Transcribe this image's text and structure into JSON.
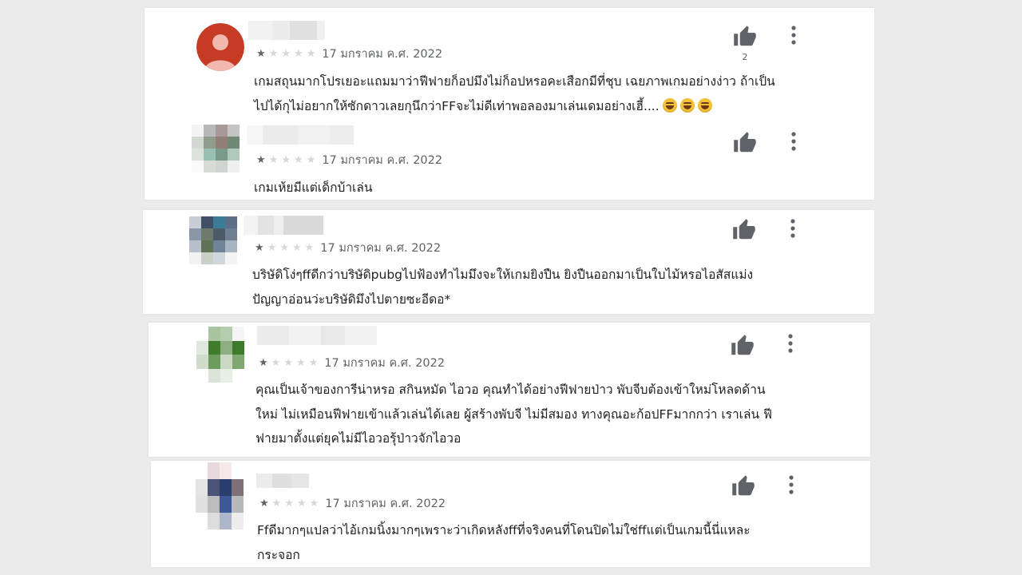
{
  "colors": {
    "background": "#ebebeb",
    "card": "#ffffff",
    "text": "#202124",
    "meta": "#5f6368",
    "star_filled": "#5f6368",
    "star_empty": "#d7d7d7",
    "avatar_1": "#c63b23"
  },
  "icons": {
    "like": "thumbs-up-icon",
    "more": "more-vertical-icon",
    "star": "star-icon",
    "emoji": "face-with-tears-of-joy-icon"
  },
  "reviews": [
    {
      "rating": 1,
      "max_rating": 5,
      "date": "17 มกราคม ค.ศ. 2022",
      "likes": "2",
      "text_lines": [
        "เกมสถุนมากโปรเยอะแถมมาว่าฟีฟายก็อปมึงไม่ก็อปหรอคะเสือกมีที่ชุบ เฉยภาพเกมอย่างง่าว ถ้าเป็น",
        "ไปได้กุไม่อยากให้ซักดาวเลยกุนึกว่าFFจะไม่ดีเท่าพอลองมาเล่นเดมอย่างเฮี้...."
      ],
      "emoji": "😂😂😂"
    },
    {
      "rating": 1,
      "max_rating": 5,
      "date": "17 มกราคม ค.ศ. 2022",
      "likes": "",
      "text_lines": [
        "เกมเห้ยมีแต่เด็กบ้าเล่น"
      ]
    },
    {
      "rating": 1,
      "max_rating": 5,
      "date": "17 มกราคม ค.ศ. 2022",
      "likes": "",
      "text_lines": [
        "บริษัดิโง่ๆffดีกว่าบริษัดิpubgไปฟ้องทำไมมึงจะให้เกมยิงปืน ยิงปืนออกมาเป็นใบไม้หรอไอสัสแม่ง",
        "ปัญญาอ่อนว่ะบริษัดิมึงไปตายซะอีดอ*"
      ]
    },
    {
      "rating": 1,
      "max_rating": 5,
      "date": "17 มกราคม ค.ศ. 2022",
      "likes": "",
      "text_lines": [
        "คุณเป็นเจ้าของการีน่าหรอ สกินหมัด ไอวอ คุณทำได้อย่างฟีฟายป่าว พับจีบต้องเข้าใหม่โหลดด้าน",
        "ใหม่ ไม่เหมือนฟีฟายเข้าแล้วเล่นได้เลย ผู้สร้างพับจี ไม่มีสมอง ทางคุณอะก้อปFFมากกว่า เราเล่น ฟี",
        "ฟายมาตั้งแต่ยุคไม่มีไอวอรุ้ป่าวจักไอวอ"
      ]
    },
    {
      "rating": 1,
      "max_rating": 5,
      "date": "17 มกราคม ค.ศ. 2022",
      "likes": "",
      "text_lines": [
        "Ffดีมากๆแปลว่าไอ้เกมนิ้งมากๆเพราะว่าเกิดหลังffที่จริงคนที่โดนปิดไม่ใช่ffแต่เป็นเกมนี้นี่แหละ",
        "กระจอก"
      ]
    }
  ]
}
